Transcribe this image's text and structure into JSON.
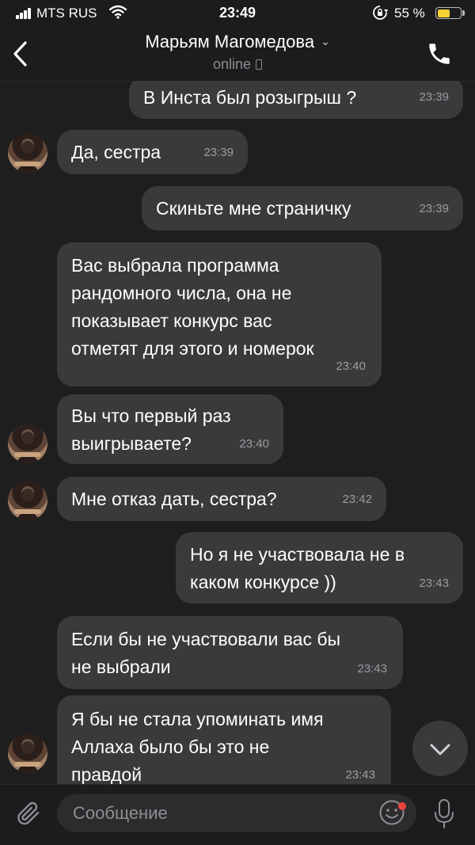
{
  "status_bar": {
    "carrier": "MTS RUS",
    "time": "23:49",
    "battery": "55 %",
    "battery_level": 0.55
  },
  "header": {
    "contact_name": "Марьям Магомедова",
    "presence": "online"
  },
  "messages": [
    {
      "dir": "out",
      "text": "В Инста был розыгрыш ?",
      "time": "23:39"
    },
    {
      "dir": "in",
      "text": "Да, сестра",
      "time": "23:39",
      "avatar": true
    },
    {
      "dir": "out",
      "text": "Скиньте мне страничку",
      "time": "23:39"
    },
    {
      "dir": "in",
      "text": "Вас выбрала программа\nрандомного числа, она не\nпоказывает конкурс вас\nотметят для этого и номерок",
      "time": "23:40",
      "avatar": false
    },
    {
      "dir": "in",
      "text": "Вы что первый раз\nвыигрываете?",
      "time": "23:40",
      "avatar": true
    },
    {
      "dir": "in",
      "text": "Мне отказ дать, сестра?",
      "time": "23:42",
      "avatar": true
    },
    {
      "dir": "out",
      "text": "Но я не участвовала не в\nкаком конкурсе ))",
      "time": "23:43"
    },
    {
      "dir": "in",
      "text": "Если бы не участвовали вас бы\nне выбрали",
      "time": "23:43",
      "avatar": false
    },
    {
      "dir": "in",
      "text": "Я бы не стала упоминать имя\nАллаха было бы это не\nправдой",
      "time": "23:43",
      "avatar": true
    }
  ],
  "composer": {
    "placeholder": "Сообщение"
  },
  "icons": [
    "signal-icon",
    "wifi-icon",
    "rotation-lock-icon",
    "battery-icon",
    "back-chevron-icon",
    "phone-call-icon",
    "scroll-down-icon",
    "attach-icon",
    "emoji-icon",
    "microphone-icon"
  ]
}
